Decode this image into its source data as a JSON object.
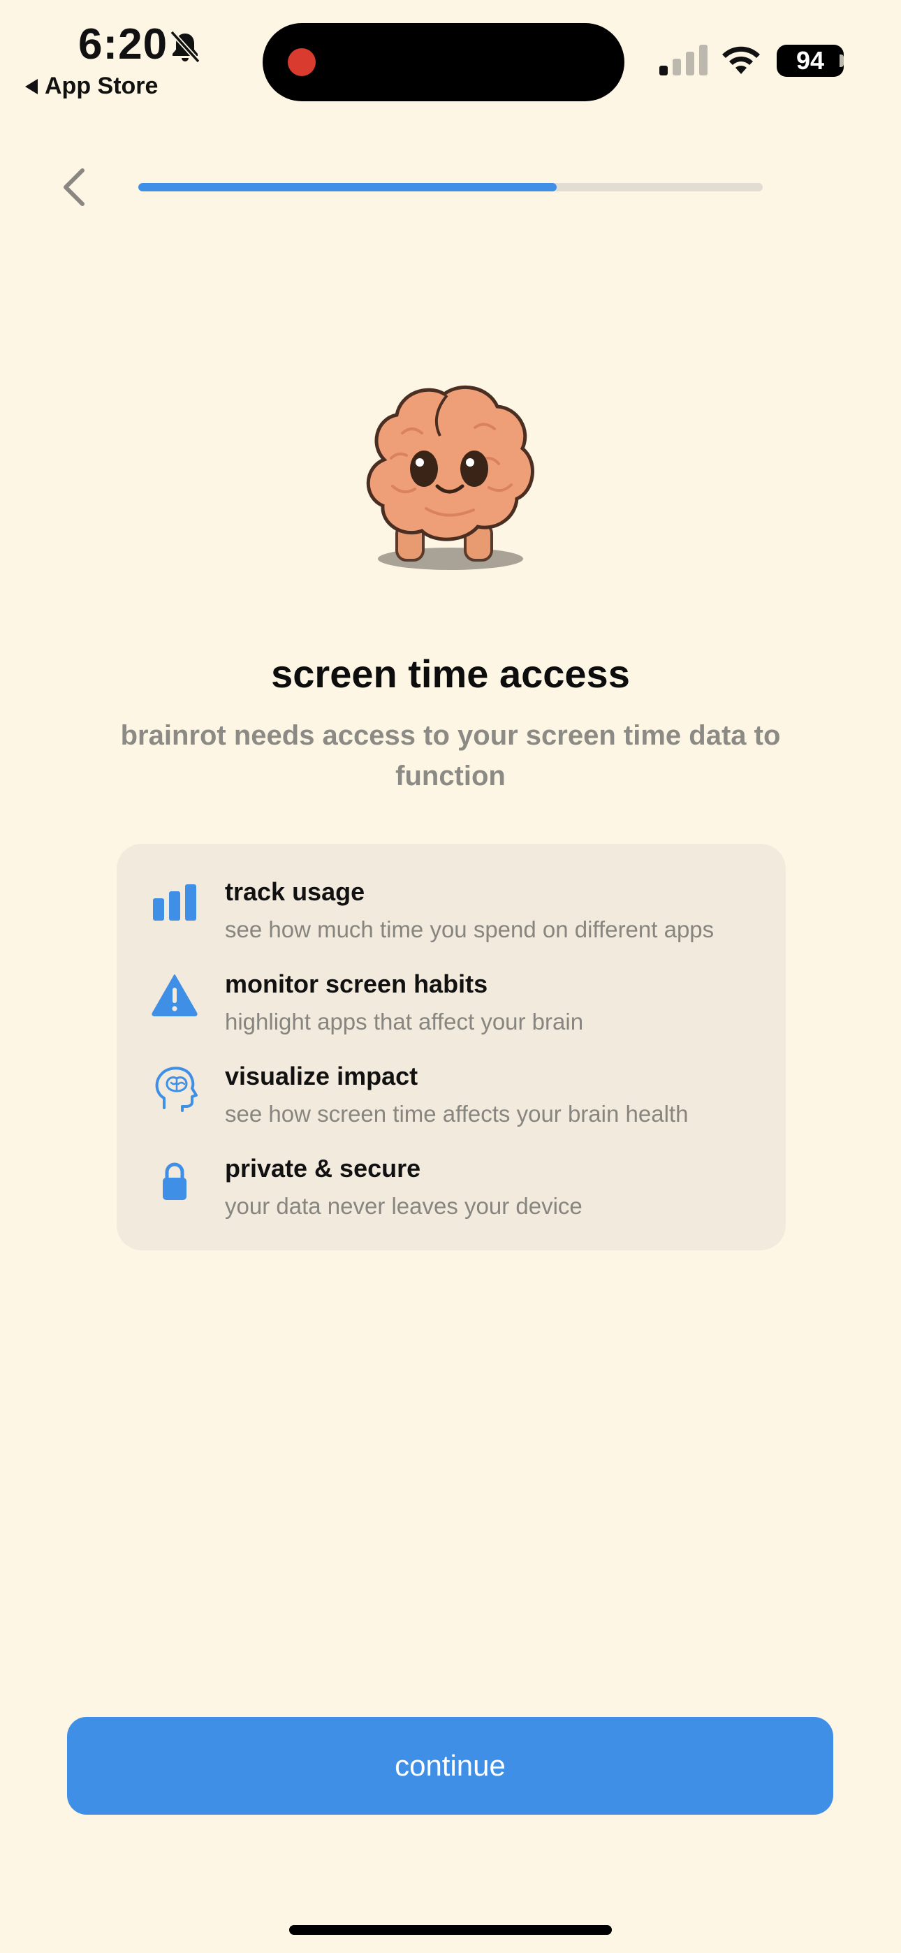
{
  "status_bar": {
    "time": "6:20",
    "back_app_label": "App Store",
    "battery": "94",
    "icons": [
      "bell-off-icon",
      "signal-icon",
      "wifi-icon",
      "battery-icon"
    ]
  },
  "onboarding": {
    "progress_fraction": 0.67
  },
  "content": {
    "title": "screen time access",
    "subtitle": "brainrot needs access to your screen time data to function"
  },
  "features": [
    {
      "icon": "bar-chart-icon",
      "title": "track usage",
      "description": "see how much time you spend on different apps"
    },
    {
      "icon": "warning-icon",
      "title": "monitor screen habits",
      "description": "highlight apps that affect your brain"
    },
    {
      "icon": "head-brain-icon",
      "title": "visualize impact",
      "description": "see how screen time affects your brain health"
    },
    {
      "icon": "lock-icon",
      "title": "private & secure",
      "description": "your data never leaves your device"
    }
  ],
  "actions": {
    "continue_label": "continue"
  },
  "colors": {
    "background": "#FDF6E4",
    "accent": "#3F8FE6",
    "card": "#F2EADC",
    "muted_text": "#878580"
  }
}
